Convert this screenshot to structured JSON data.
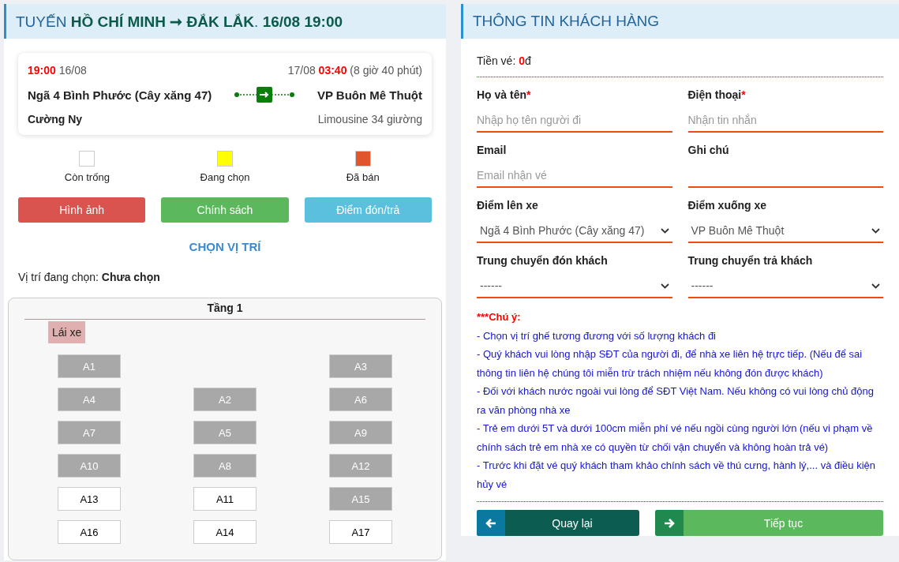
{
  "route": {
    "title": "TUYẾN **HỒ CHÍ MINH ➞ ĐẮK LẮK**. **16/08 19:00**"
  },
  "trip": {
    "depart_time": "19:00",
    "depart_date": "16/08",
    "arrive_date": "17/08",
    "arrive_time": "03:40",
    "duration": "(8 giờ 40 phút)",
    "origin": "Ngã 4 Bình Phước (Cây xăng 47)",
    "destination": "VP Buôn Mê Thuột",
    "operator": "Cường Ny",
    "vehicle": "Limousine 34 giường"
  },
  "legend": [
    {
      "label": "Còn trống",
      "color": "#ffffff"
    },
    {
      "label": "Đang chọn",
      "color": "#ffff00"
    },
    {
      "label": "Đã bán",
      "color": "#e0552b"
    }
  ],
  "action_buttons": [
    {
      "label": "Hình ảnh",
      "kind": "danger"
    },
    {
      "label": "Chính sách",
      "kind": "success"
    },
    {
      "label": "Điểm đón/trả",
      "kind": "info"
    }
  ],
  "seat_section": {
    "heading": "CHỌN VỊ TRÍ",
    "selected_label": "Vị trí đang chọn:",
    "selected_value": "Chưa chọn"
  },
  "deck": {
    "title": "Tầng 1",
    "driver": "Lái xe",
    "rows": [
      [
        {
          "kind": "seat",
          "label": "A1",
          "disabled": true
        },
        {
          "kind": "gap"
        },
        {
          "kind": "seat",
          "label": "A3",
          "disabled": true
        }
      ],
      [
        {
          "kind": "seat",
          "label": "A4",
          "disabled": true
        },
        {
          "kind": "seat",
          "label": "A2",
          "disabled": true
        },
        {
          "kind": "seat",
          "label": "A6",
          "disabled": true
        }
      ],
      [
        {
          "kind": "seat",
          "label": "A7",
          "disabled": true
        },
        {
          "kind": "seat",
          "label": "A5",
          "disabled": true
        },
        {
          "kind": "seat",
          "label": "A9",
          "disabled": true
        }
      ],
      [
        {
          "kind": "seat",
          "label": "A10",
          "disabled": true
        },
        {
          "kind": "seat",
          "label": "A8",
          "disabled": true
        },
        {
          "kind": "seat",
          "label": "A12",
          "disabled": true
        }
      ],
      [
        {
          "kind": "seat",
          "label": "A13",
          "disabled": false
        },
        {
          "kind": "seat",
          "label": "A11",
          "disabled": false
        },
        {
          "kind": "seat",
          "label": "A15",
          "disabled": true
        }
      ],
      [
        {
          "kind": "seat",
          "label": "A16",
          "disabled": false
        },
        {
          "kind": "seat",
          "label": "A14",
          "disabled": false
        },
        {
          "kind": "seat",
          "label": "A17",
          "disabled": false
        }
      ]
    ]
  },
  "customer": {
    "title": "THÔNG TIN KHÁCH HÀNG",
    "fare_label": "Tiền vé:",
    "fare_amount": "0",
    "fare_currency": "đ",
    "fields": [
      {
        "kind": "input",
        "label": "Họ và tên",
        "required_mark": "*",
        "placeholder": "Nhập họ tên người đi"
      },
      {
        "kind": "input",
        "label": "Điện thoại",
        "required_mark": "*",
        "placeholder": "Nhận tin nhắn"
      },
      {
        "kind": "input",
        "label": "Email",
        "placeholder": "Email nhận vé"
      },
      {
        "kind": "input",
        "label": "Ghi chú"
      },
      {
        "kind": "select",
        "label": "Điểm lên xe",
        "value": "Ngã 4 Bình Phước (Cây xăng 47)"
      },
      {
        "kind": "select",
        "label": "Điểm xuống xe",
        "value": "VP Buôn Mê Thuột"
      },
      {
        "kind": "select",
        "label": "Trung chuyển đón khách",
        "value": "------"
      },
      {
        "kind": "select",
        "label": "Trung chuyển trả khách",
        "value": "------"
      }
    ],
    "notice_title": "***Chú ý:",
    "notices": [
      "- Chọn vị trí ghế tương đương với số lượng khách đi",
      "- Quý khách vui lòng nhập SĐT của người đi, để nhà xe liên hệ trực tiếp. (Nếu để sai thông tin liên hệ chúng tôi miễn trừ trách nhiệm nếu không đón được khách)",
      "- Đối với khách nước ngoài vui lòng để SĐT Việt Nam. Nếu không có vui lòng chủ động ra văn phòng nhà xe",
      "- Trẻ em dưới 5T và dưới 100cm miễn phí vé nếu ngồi cùng người lớn (nếu vi phạm về chính sách trẻ em nhà xe có quyền từ chối vận chuyển và không hoàn trả vé)",
      "- Trước khi đặt vé quý khách tham khảo chính sách về thú cưng, hành lý,... và điều kiện hủy vé"
    ],
    "back_button": "Quay lại",
    "next_button": "Tiếp tục"
  }
}
